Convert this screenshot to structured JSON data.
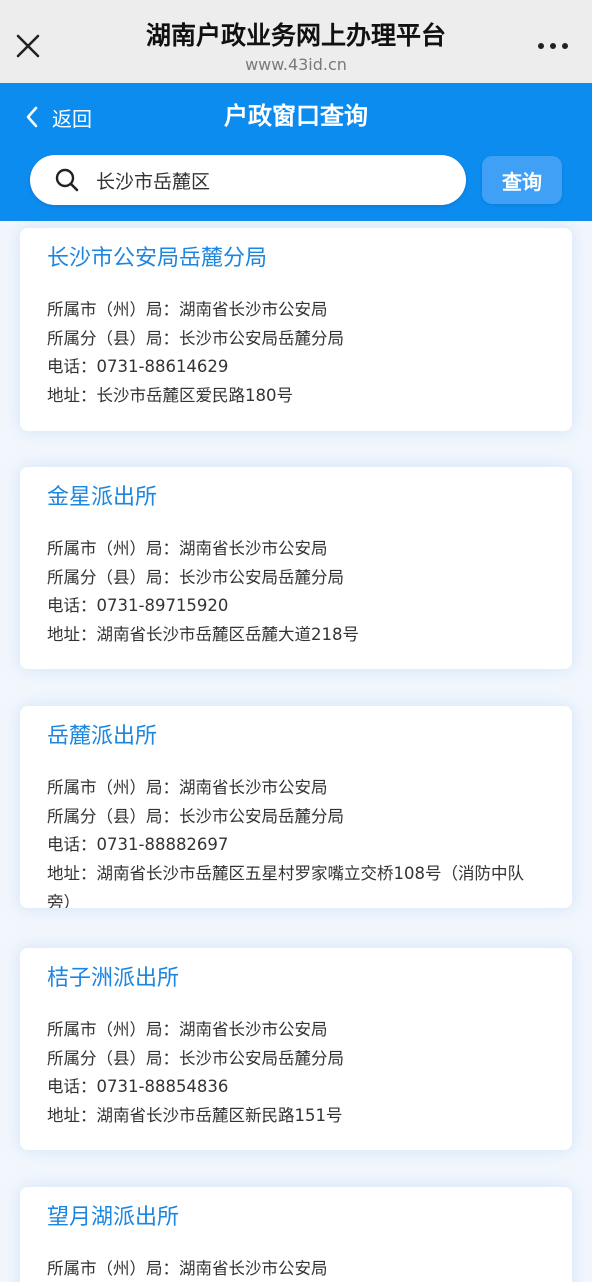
{
  "browser": {
    "title": "湖南户政业务网上办理平台",
    "url": "www.43id.cn"
  },
  "header": {
    "back_label": "返回",
    "title": "户政窗口查询",
    "search_value": "长沙市岳麓区",
    "query_label": "查询",
    "accent_color": "#0d8cf0"
  },
  "cards": [
    {
      "name": "长沙市公安局岳麓分局",
      "city": "所属市（州）局：湖南省长沙市公安局",
      "district": "所属分（县）局：长沙市公安局岳麓分局",
      "phone": "电话：0731-88614629",
      "address": "地址：长沙市岳麓区爱民路180号"
    },
    {
      "name": "金星派出所",
      "city": "所属市（州）局：湖南省长沙市公安局",
      "district": "所属分（县）局：长沙市公安局岳麓分局",
      "phone": "电话：0731-89715920",
      "address": "地址：湖南省长沙市岳麓区岳麓大道218号"
    },
    {
      "name": "岳麓派出所",
      "city": "所属市（州）局：湖南省长沙市公安局",
      "district": "所属分（县）局：长沙市公安局岳麓分局",
      "phone": "电话：0731-88882697",
      "address": "地址：湖南省长沙市岳麓区五星村罗家嘴立交桥108号（消防中队旁）"
    },
    {
      "name": "桔子洲派出所",
      "city": "所属市（州）局：湖南省长沙市公安局",
      "district": "所属分（县）局：长沙市公安局岳麓分局",
      "phone": "电话：0731-88854836",
      "address": "地址：湖南省长沙市岳麓区新民路151号"
    },
    {
      "name": "望月湖派出所",
      "city": "所属市（州）局：湖南省长沙市公安局"
    }
  ]
}
